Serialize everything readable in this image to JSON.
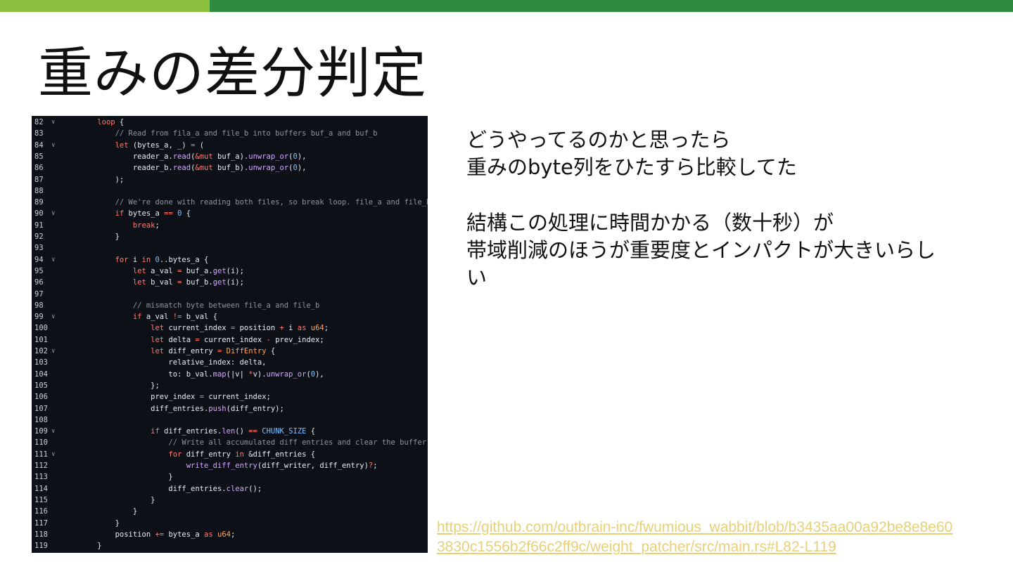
{
  "slide": {
    "title": "重みの差分判定",
    "accent_colors": {
      "light": "#8dc03f",
      "dark": "#2f8c3f"
    },
    "body": {
      "para1_line1": "どうやってるのかと思ったら",
      "para1_line2": "重みのbyte列をひたすら比較してた",
      "para2_line1": "結構この処理に時間かかる（数十秒）が",
      "para2_line2": "帯域削減のほうが重要度とインパクトが大きいらし",
      "para2_line3": "い"
    },
    "source_link_line1": "https://github.com/outbrain-inc/fwumious_wabbit/blob/b3435aa00a92be8e8e60",
    "source_link_line2": "3830c1556b2f66c2ff9c/weight_patcher/src/main.rs#L82-L119"
  },
  "code": {
    "lines": [
      {
        "n": "82",
        "fold": true,
        "tokens": [
          [
            "    ",
            ""
          ],
          [
            "loop",
            "kw"
          ],
          [
            " {",
            ""
          ]
        ]
      },
      {
        "n": "83",
        "fold": false,
        "tokens": [
          [
            "        ",
            ""
          ],
          [
            "// Read from fila_a and file_b into buffers buf_a and buf_b",
            "cm"
          ]
        ]
      },
      {
        "n": "84",
        "fold": true,
        "tokens": [
          [
            "        ",
            ""
          ],
          [
            "let",
            "kw"
          ],
          [
            " (bytes_a, _) ",
            ""
          ],
          [
            "=",
            "kw"
          ],
          [
            " (",
            ""
          ]
        ]
      },
      {
        "n": "85",
        "fold": false,
        "tokens": [
          [
            "            reader_a.",
            ""
          ],
          [
            "read",
            "fn"
          ],
          [
            "(",
            ""
          ],
          [
            "&mut",
            "kw"
          ],
          [
            " buf_a).",
            ""
          ],
          [
            "unwrap_or",
            "fn"
          ],
          [
            "(",
            ""
          ],
          [
            "0",
            "nm"
          ],
          [
            "),",
            ""
          ]
        ]
      },
      {
        "n": "86",
        "fold": false,
        "tokens": [
          [
            "            reader_b.",
            ""
          ],
          [
            "read",
            "fn"
          ],
          [
            "(",
            ""
          ],
          [
            "&mut",
            "kw"
          ],
          [
            " buf_b).",
            ""
          ],
          [
            "unwrap_or",
            "fn"
          ],
          [
            "(",
            ""
          ],
          [
            "0",
            "nm"
          ],
          [
            "),",
            ""
          ]
        ]
      },
      {
        "n": "87",
        "fold": false,
        "tokens": [
          [
            "        );",
            ""
          ]
        ]
      },
      {
        "n": "88",
        "fold": false,
        "tokens": []
      },
      {
        "n": "89",
        "fold": false,
        "tokens": [
          [
            "        ",
            ""
          ],
          [
            "// We're done with reading both files, so break loop. file_a and file_b",
            "cm"
          ]
        ]
      },
      {
        "n": "90",
        "fold": true,
        "tokens": [
          [
            "        ",
            ""
          ],
          [
            "if",
            "kw"
          ],
          [
            " bytes_a ",
            ""
          ],
          [
            "==",
            "kw"
          ],
          [
            " ",
            ""
          ],
          [
            "0",
            "nm"
          ],
          [
            " {",
            ""
          ]
        ]
      },
      {
        "n": "91",
        "fold": false,
        "tokens": [
          [
            "            ",
            ""
          ],
          [
            "break",
            "kw"
          ],
          [
            ";",
            ""
          ]
        ]
      },
      {
        "n": "92",
        "fold": false,
        "tokens": [
          [
            "        }",
            ""
          ]
        ]
      },
      {
        "n": "93",
        "fold": false,
        "tokens": []
      },
      {
        "n": "94",
        "fold": true,
        "tokens": [
          [
            "        ",
            ""
          ],
          [
            "for",
            "kw"
          ],
          [
            " i ",
            ""
          ],
          [
            "in",
            "kw"
          ],
          [
            " ",
            ""
          ],
          [
            "0",
            "nm"
          ],
          [
            "..bytes_a {",
            ""
          ]
        ]
      },
      {
        "n": "95",
        "fold": false,
        "tokens": [
          [
            "            ",
            ""
          ],
          [
            "let",
            "kw"
          ],
          [
            " a_val ",
            ""
          ],
          [
            "=",
            "kw"
          ],
          [
            " buf_a.",
            ""
          ],
          [
            "get",
            "fn"
          ],
          [
            "(i);",
            ""
          ]
        ]
      },
      {
        "n": "96",
        "fold": false,
        "tokens": [
          [
            "            ",
            ""
          ],
          [
            "let",
            "kw"
          ],
          [
            " b_val ",
            ""
          ],
          [
            "=",
            "kw"
          ],
          [
            " buf_b.",
            ""
          ],
          [
            "get",
            "fn"
          ],
          [
            "(i);",
            ""
          ]
        ]
      },
      {
        "n": "97",
        "fold": false,
        "tokens": []
      },
      {
        "n": "98",
        "fold": false,
        "tokens": [
          [
            "            ",
            ""
          ],
          [
            "// mismatch byte between file_a and file_b",
            "cm"
          ]
        ]
      },
      {
        "n": "99",
        "fold": true,
        "tokens": [
          [
            "            ",
            ""
          ],
          [
            "if",
            "kw"
          ],
          [
            " a_val ",
            ""
          ],
          [
            "!=",
            "kw"
          ],
          [
            " b_val {",
            ""
          ]
        ]
      },
      {
        "n": "100",
        "fold": false,
        "tokens": [
          [
            "                ",
            ""
          ],
          [
            "let",
            "kw"
          ],
          [
            " current_index ",
            ""
          ],
          [
            "=",
            "kw"
          ],
          [
            " position ",
            ""
          ],
          [
            "+",
            "kw"
          ],
          [
            " i ",
            ""
          ],
          [
            "as",
            "kw"
          ],
          [
            " ",
            ""
          ],
          [
            "u64",
            "ty"
          ],
          [
            ";",
            ""
          ]
        ]
      },
      {
        "n": "101",
        "fold": false,
        "tokens": [
          [
            "                ",
            ""
          ],
          [
            "let",
            "kw"
          ],
          [
            " delta ",
            ""
          ],
          [
            "=",
            "kw"
          ],
          [
            " current_index ",
            ""
          ],
          [
            "-",
            "kw"
          ],
          [
            " prev_index;",
            ""
          ]
        ]
      },
      {
        "n": "102",
        "fold": true,
        "tokens": [
          [
            "                ",
            ""
          ],
          [
            "let",
            "kw"
          ],
          [
            " diff_entry ",
            ""
          ],
          [
            "=",
            "kw"
          ],
          [
            " ",
            ""
          ],
          [
            "DiffEntry",
            "ty"
          ],
          [
            " {",
            ""
          ]
        ]
      },
      {
        "n": "103",
        "fold": false,
        "tokens": [
          [
            "                    relative_index: delta,",
            ""
          ]
        ]
      },
      {
        "n": "104",
        "fold": false,
        "tokens": [
          [
            "                    to: b_val.",
            ""
          ],
          [
            "map",
            "fn"
          ],
          [
            "(|v| ",
            ""
          ],
          [
            "*",
            "kw"
          ],
          [
            "v).",
            ""
          ],
          [
            "unwrap_or",
            "fn"
          ],
          [
            "(",
            ""
          ],
          [
            "0",
            "nm"
          ],
          [
            "),",
            ""
          ]
        ]
      },
      {
        "n": "105",
        "fold": false,
        "tokens": [
          [
            "                };",
            ""
          ]
        ]
      },
      {
        "n": "106",
        "fold": false,
        "tokens": [
          [
            "                prev_index ",
            ""
          ],
          [
            "=",
            "kw"
          ],
          [
            " current_index;",
            ""
          ]
        ]
      },
      {
        "n": "107",
        "fold": false,
        "tokens": [
          [
            "                diff_entries.",
            ""
          ],
          [
            "push",
            "fn"
          ],
          [
            "(diff_entry);",
            ""
          ]
        ]
      },
      {
        "n": "108",
        "fold": false,
        "tokens": []
      },
      {
        "n": "109",
        "fold": true,
        "tokens": [
          [
            "                ",
            ""
          ],
          [
            "if",
            "kw"
          ],
          [
            " diff_entries.",
            ""
          ],
          [
            "len",
            "fn"
          ],
          [
            "() ",
            ""
          ],
          [
            "==",
            "kw"
          ],
          [
            " ",
            ""
          ],
          [
            "CHUNK_SIZE",
            "nm"
          ],
          [
            " {",
            ""
          ]
        ]
      },
      {
        "n": "110",
        "fold": false,
        "tokens": [
          [
            "                    ",
            ""
          ],
          [
            "// Write all accumulated diff entries and clear the buffer",
            "cm"
          ]
        ]
      },
      {
        "n": "111",
        "fold": true,
        "tokens": [
          [
            "                    ",
            ""
          ],
          [
            "for",
            "kw"
          ],
          [
            " diff_entry ",
            ""
          ],
          [
            "in",
            "kw"
          ],
          [
            " &diff_entries {",
            ""
          ]
        ]
      },
      {
        "n": "112",
        "fold": false,
        "tokens": [
          [
            "                        ",
            ""
          ],
          [
            "write_diff_entry",
            "fn"
          ],
          [
            "(diff_writer, diff_entry)",
            ""
          ],
          [
            "?",
            "kw"
          ],
          [
            ";",
            ""
          ]
        ]
      },
      {
        "n": "113",
        "fold": false,
        "tokens": [
          [
            "                    }",
            ""
          ]
        ]
      },
      {
        "n": "114",
        "fold": false,
        "tokens": [
          [
            "                    diff_entries.",
            ""
          ],
          [
            "clear",
            "fn"
          ],
          [
            "();",
            ""
          ]
        ]
      },
      {
        "n": "115",
        "fold": false,
        "tokens": [
          [
            "                }",
            ""
          ]
        ]
      },
      {
        "n": "116",
        "fold": false,
        "tokens": [
          [
            "            }",
            ""
          ]
        ]
      },
      {
        "n": "117",
        "fold": false,
        "tokens": [
          [
            "        }",
            ""
          ]
        ]
      },
      {
        "n": "118",
        "fold": false,
        "tokens": [
          [
            "        position ",
            ""
          ],
          [
            "+=",
            "kw"
          ],
          [
            " bytes_a ",
            ""
          ],
          [
            "as",
            "kw"
          ],
          [
            " ",
            ""
          ],
          [
            "u64",
            "ty"
          ],
          [
            ";",
            ""
          ]
        ]
      },
      {
        "n": "119",
        "fold": false,
        "tokens": [
          [
            "    }",
            ""
          ]
        ]
      }
    ]
  }
}
